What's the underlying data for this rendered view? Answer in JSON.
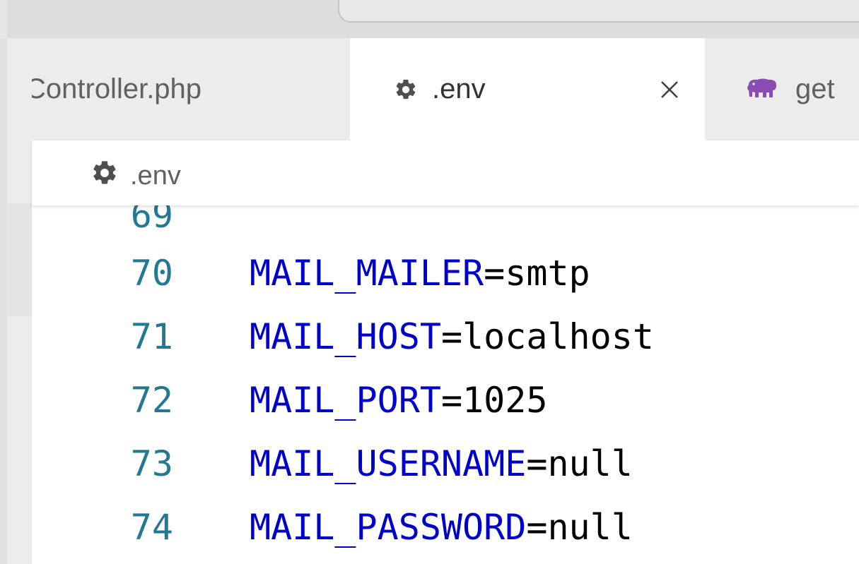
{
  "tabs": [
    {
      "label": "Controller.php",
      "active": false
    },
    {
      "label": ".env",
      "active": true,
      "icon": "gear-icon"
    },
    {
      "label": "get",
      "active": false,
      "icon": "php-elephant-icon"
    }
  ],
  "breadcrumb": {
    "label": ".env",
    "icon": "gear-icon"
  },
  "editor": {
    "lines": [
      {
        "number": "69",
        "key": "",
        "eq": "",
        "value": ""
      },
      {
        "number": "70",
        "key": "MAIL_MAILER",
        "eq": "=",
        "value": "smtp"
      },
      {
        "number": "71",
        "key": "MAIL_HOST",
        "eq": "=",
        "value": "localhost"
      },
      {
        "number": "72",
        "key": "MAIL_PORT",
        "eq": "=",
        "value": "1025"
      },
      {
        "number": "73",
        "key": "MAIL_USERNAME",
        "eq": "=",
        "value": "null"
      },
      {
        "number": "74",
        "key": "MAIL_PASSWORD",
        "eq": "=",
        "value": "null"
      }
    ]
  },
  "colors": {
    "line_number": "#237893",
    "env_key": "#0000cd",
    "env_value": "#000000",
    "icon_gear": "#4f4f4f",
    "php_icon": "#8a4db3"
  }
}
